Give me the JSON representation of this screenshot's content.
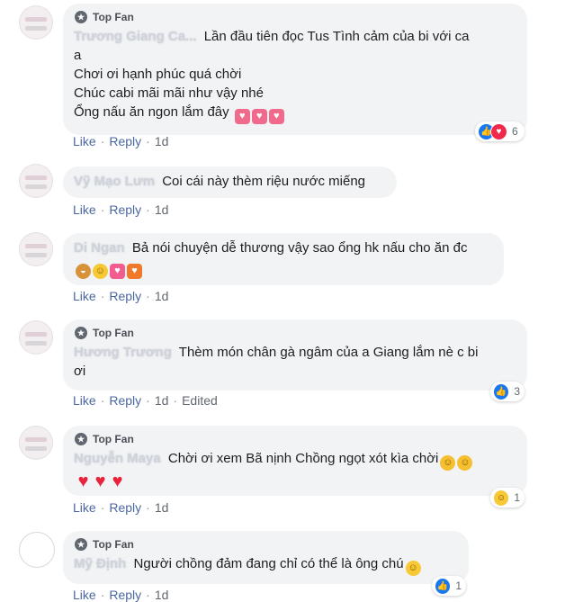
{
  "labels": {
    "top_fan": "Top Fan",
    "like": "Like",
    "reply": "Reply",
    "edited": "Edited"
  },
  "comments": [
    {
      "top_fan": true,
      "author": "Trương Giang Ca...",
      "lines": [
        "Lần đầu tiên đọc Tus Tình cảm của bi với ca",
        "a",
        "Chơi ơi hạnh phúc quá chời",
        "Chúc cabi mãi mãi như vậy nhé",
        "Ổng nấu ăn ngon lắm đây"
      ],
      "emojis": [
        "heart-sparkle-icon",
        "heart-sparkle-icon",
        "heart-sparkle-icon"
      ],
      "time": "1d",
      "reaction_count": "6",
      "reaction_icons": [
        "like-reaction-icon",
        "love-reaction-icon"
      ]
    },
    {
      "top_fan": false,
      "author": "Vỹ Mạo Lưm",
      "lines": [
        "Coi cái này thèm riệu nước miếng"
      ],
      "time": "1d"
    },
    {
      "top_fan": false,
      "author": "Di Ngan",
      "lines": [
        "Bả nói chuyện dễ thương vậy sao ổng hk nấu cho ăn đc"
      ],
      "emojis": [
        "burger-icon",
        "laughing-icon",
        "heart-icon",
        "gift-heart-icon"
      ],
      "time": "1d"
    },
    {
      "top_fan": true,
      "author": "Hương Trương",
      "lines": [
        "Thèm món chân gà ngâm của a Giang lắm nè c bi",
        "ơi"
      ],
      "time": "1d",
      "edited": true,
      "reaction_count": "3",
      "reaction_icons": [
        "like-reaction-icon"
      ]
    },
    {
      "top_fan": true,
      "author": "Nguyễn Maya",
      "lines": [
        "Chời ơi xem Bã nịnh Chồng ngọt xót kìa chời"
      ],
      "emojis": [
        "rofl-icon",
        "rofl-icon",
        "heart-icon",
        "heart-icon",
        "heart-icon"
      ],
      "time": "1d",
      "reaction_count": "1",
      "reaction_icons": [
        "haha-reaction-icon"
      ]
    },
    {
      "top_fan": true,
      "author": "Mỹ Định",
      "lines": [
        "Người chồng đảm đang chỉ có thể là ông chú"
      ],
      "emojis": [
        "laughing-icon"
      ],
      "time": "1d",
      "reaction_count": "1",
      "reaction_icons": [
        "like-reaction-icon"
      ]
    }
  ]
}
